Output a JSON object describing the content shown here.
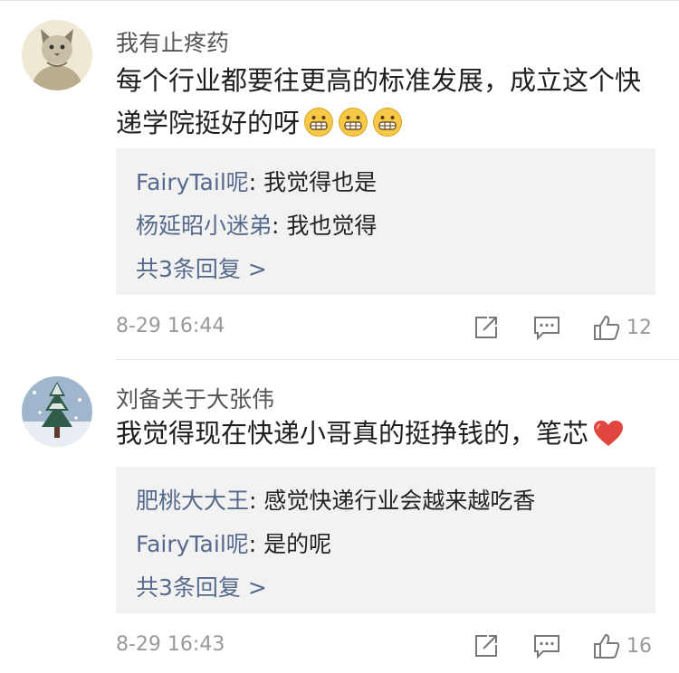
{
  "comments": [
    {
      "username": "我有止疼药",
      "text": "每个行业都要往更高的标准发展，成立这个快递学院挺好的呀",
      "emoji_count": 3,
      "replies": [
        {
          "name": "FairyTail呢",
          "text": ": 我觉得也是"
        },
        {
          "name": "杨延昭小迷弟",
          "text": ": 我也觉得"
        }
      ],
      "more_replies": "共3条回复 >",
      "time": "8-29 16:44",
      "likes": "12"
    },
    {
      "username": "刘备关于大张伟",
      "text": "我觉得现在快递小哥真的挺挣钱的，笔芯",
      "emoji_count": 1,
      "replies": [
        {
          "name": "肥桃大大王",
          "text": ": 感觉快递行业会越来越吃香"
        },
        {
          "name": "FairyTail呢",
          "text": ": 是的呢"
        }
      ],
      "more_replies": "共3条回复 >",
      "time": "8-29 16:43",
      "likes": "16"
    }
  ],
  "icons": {
    "share": "share-icon",
    "comment": "comment-icon",
    "like": "thumbs-up-icon",
    "grin": "grinning-face-icon",
    "heart": "red-heart-icon"
  },
  "colors": {
    "reply_name": "#566a8c",
    "reply_bg": "#f2f2f2",
    "meta": "#999999",
    "heart": "#e0463e",
    "emoji": "#f7c948"
  }
}
